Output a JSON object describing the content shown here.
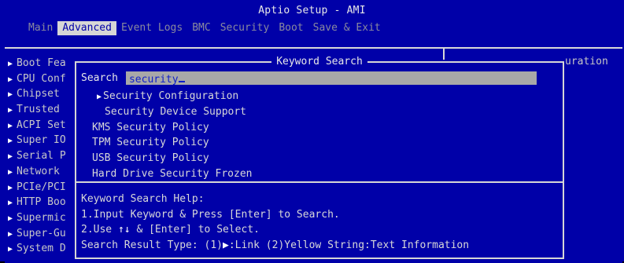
{
  "app": {
    "title": "Aptio Setup - AMI"
  },
  "tabs": [
    {
      "label": "Main"
    },
    {
      "label": "Advanced"
    },
    {
      "label": "Event Logs"
    },
    {
      "label": "BMC"
    },
    {
      "label": "Security"
    },
    {
      "label": "Boot"
    },
    {
      "label": "Save & Exit"
    }
  ],
  "background": {
    "right_text": "uration",
    "items": [
      {
        "label": "Boot Fea"
      },
      {
        "label": "CPU Conf"
      },
      {
        "label": "Chipset"
      },
      {
        "label": "Trusted"
      },
      {
        "label": "ACPI Set"
      },
      {
        "label": "Super IO"
      },
      {
        "label": "Serial P"
      },
      {
        "label": "Network"
      },
      {
        "label": "PCIe/PCI"
      },
      {
        "label": "HTTP Boo"
      },
      {
        "label": "Supermic"
      },
      {
        "label": "Super-Gu"
      },
      {
        "label": "System D"
      }
    ]
  },
  "dialog": {
    "title": "Keyword Search",
    "search_label": "Search",
    "search_value": "security",
    "results": [
      {
        "label": "Security Configuration",
        "type": "link"
      },
      {
        "label": "Security Device Support",
        "type": "sub"
      },
      {
        "label": "KMS Security Policy",
        "type": "item"
      },
      {
        "label": "TPM Security Policy",
        "type": "item"
      },
      {
        "label": "USB Security Policy",
        "type": "item"
      },
      {
        "label": "Hard Drive Security Frozen",
        "type": "item"
      }
    ],
    "help": {
      "title": "Keyword Search Help:",
      "line1": "1.Input Keyword & Press [Enter] to Search.",
      "line2_prefix": "2.Use ",
      "line2_keys": "↑↓",
      "line2_suffix": " & [Enter] to Select.",
      "line3_prefix": "Search Result Type: (1)",
      "line3_suffix": ":Link (2)Yellow String:Text Information"
    }
  },
  "colors": {
    "background_blue": "#0000a8",
    "active_tab_bg": "#d6d6d6",
    "search_field_bg": "#a8a8a8"
  }
}
